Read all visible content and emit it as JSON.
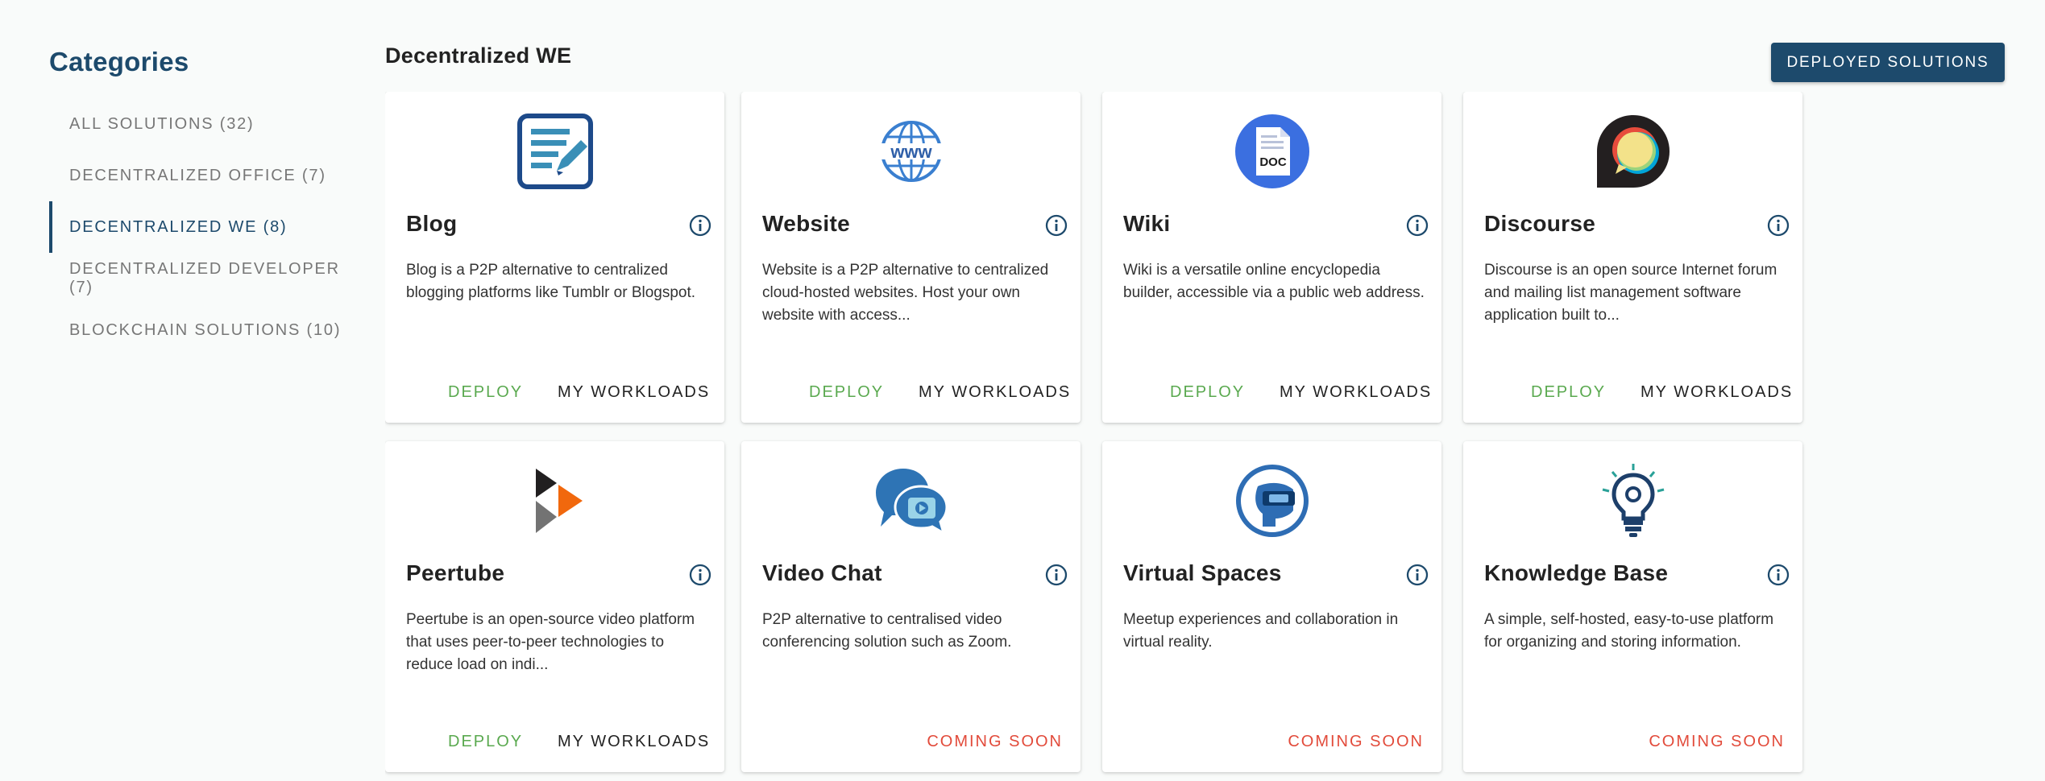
{
  "sidebar": {
    "title": "Categories",
    "items": [
      {
        "label": "ALL SOLUTIONS (32)"
      },
      {
        "label": "DECENTRALIZED OFFICE (7)"
      },
      {
        "label": "DECENTRALIZED WE (8)",
        "active": true
      },
      {
        "label": "DECENTRALIZED DEVELOPER (7)"
      },
      {
        "label": "BLOCKCHAIN SOLUTIONS (10)"
      }
    ]
  },
  "main": {
    "title": "Decentralized WE",
    "deployed_button": "DEPLOYED SOLUTIONS"
  },
  "cards": [
    {
      "title": "Blog",
      "icon": "blog-icon",
      "description": "Blog is a P2P alternative to centralized blogging platforms like Tumblr or Blogspot.",
      "deploy": "DEPLOY",
      "workloads": "MY WORKLOADS"
    },
    {
      "title": "Website",
      "icon": "www-globe-icon",
      "description": "Website is a P2P alternative to centralized cloud-hosted websites. Host your own website with access...",
      "deploy": "DEPLOY",
      "workloads": "MY WORKLOADS"
    },
    {
      "title": "Wiki",
      "icon": "doc-icon",
      "description": "Wiki is a versatile online encyclopedia builder, accessible via a public web address.",
      "deploy": "DEPLOY",
      "workloads": "MY WORKLOADS"
    },
    {
      "title": "Discourse",
      "icon": "discourse-icon",
      "description": "Discourse is an open source Internet forum and mailing list management software application built to...",
      "deploy": "DEPLOY",
      "workloads": "MY WORKLOADS"
    },
    {
      "title": "Peertube",
      "icon": "peertube-icon",
      "description": "Peertube is an open-source video platform that uses peer-to-peer technologies to reduce load on indi...",
      "deploy": "DEPLOY",
      "workloads": "MY WORKLOADS"
    },
    {
      "title": "Video Chat",
      "icon": "video-chat-icon",
      "description": "P2P alternative to centralised video conferencing solution such as Zoom.",
      "status": "COMING SOON"
    },
    {
      "title": "Virtual Spaces",
      "icon": "vr-headset-icon",
      "description": "Meetup experiences and collaboration in virtual reality.",
      "status": "COMING SOON"
    },
    {
      "title": "Knowledge Base",
      "icon": "lightbulb-icon",
      "description": "A simple, self-hosted, easy-to-use platform for organizing and storing information.",
      "status": "COMING SOON"
    }
  ],
  "colors": {
    "accent": "#1d4a6c",
    "deploy": "#5aa94f",
    "coming_soon": "#e24b3b"
  }
}
